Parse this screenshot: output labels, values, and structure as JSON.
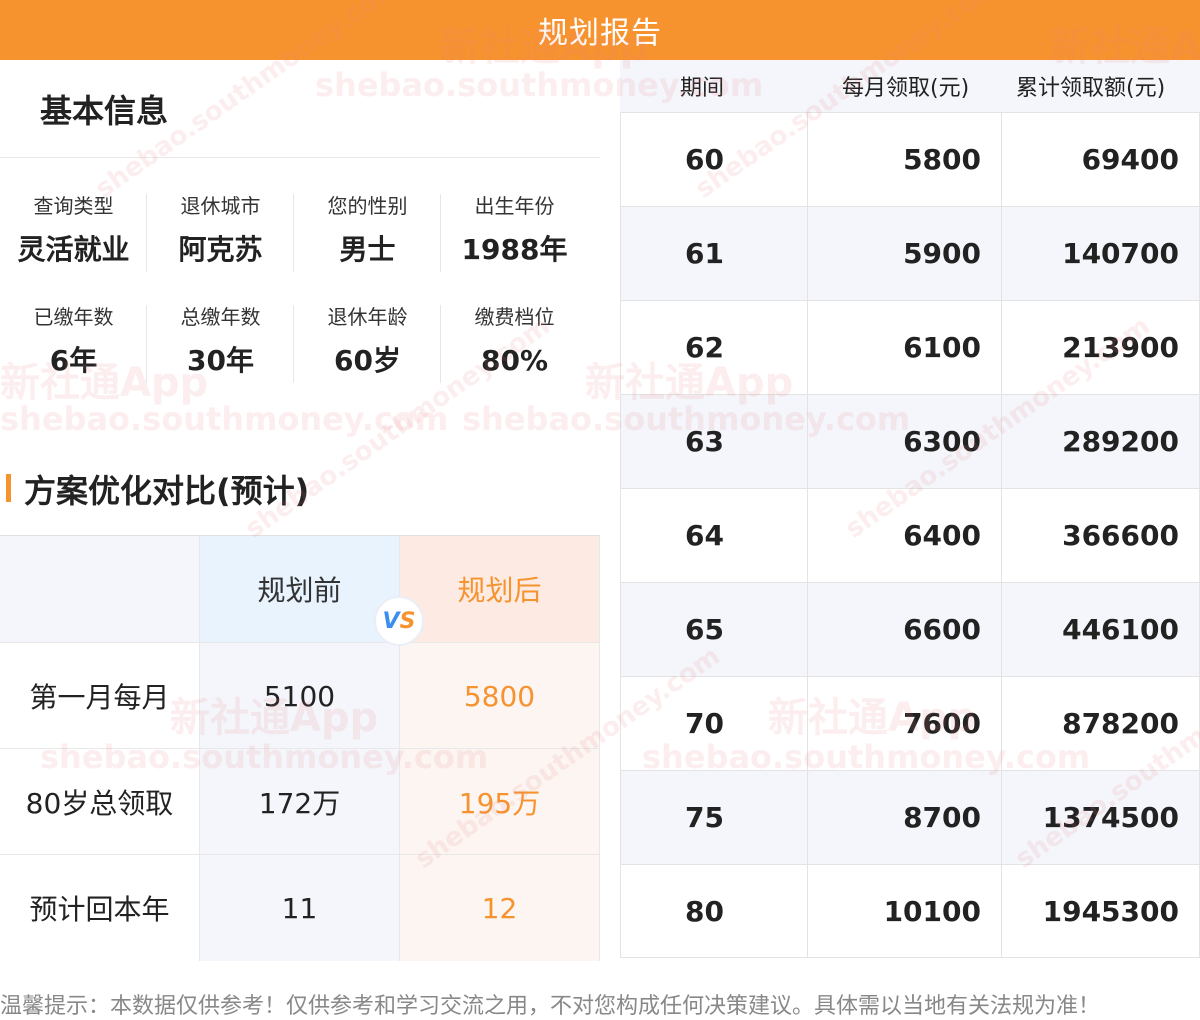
{
  "header": {
    "title": "规划报告"
  },
  "basic_info": {
    "title": "基本信息",
    "items": [
      {
        "label": "查询类型",
        "value": "灵活就业"
      },
      {
        "label": "退休城市",
        "value": "阿克苏"
      },
      {
        "label": "您的性别",
        "value": "男士"
      },
      {
        "label": "出生年份",
        "value": "1988年"
      },
      {
        "label": "已缴年数",
        "value": "6年"
      },
      {
        "label": "总缴年数",
        "value": "30年"
      },
      {
        "label": "退休年龄",
        "value": "60岁"
      },
      {
        "label": "缴费档位",
        "value": "80%"
      }
    ]
  },
  "comparison": {
    "title": "方案优化对比(预计)",
    "before_label": "规划前",
    "after_label": "规划后",
    "vs_v": "V",
    "vs_s": "S",
    "rows": [
      {
        "label": "第一月每月",
        "before": "5100",
        "after": "5800"
      },
      {
        "label": "80岁总领取",
        "before": "172万",
        "after": "195万"
      },
      {
        "label": "预计回本年",
        "before": "11",
        "after": "12"
      }
    ]
  },
  "payout_table": {
    "headers": [
      "期间",
      "每月领取(元)",
      "累计领取额(元)"
    ],
    "rows": [
      {
        "period": "60",
        "monthly": "5800",
        "total": "69400"
      },
      {
        "period": "61",
        "monthly": "5900",
        "total": "140700"
      },
      {
        "period": "62",
        "monthly": "6100",
        "total": "213900"
      },
      {
        "period": "63",
        "monthly": "6300",
        "total": "289200"
      },
      {
        "period": "64",
        "monthly": "6400",
        "total": "366600"
      },
      {
        "period": "65",
        "monthly": "6600",
        "total": "446100"
      },
      {
        "period": "70",
        "monthly": "7600",
        "total": "878200"
      },
      {
        "period": "75",
        "monthly": "8700",
        "total": "1374500"
      },
      {
        "period": "80",
        "monthly": "10100",
        "total": "1945300"
      }
    ]
  },
  "footer": {
    "notice": "温馨提示：本数据仅供参考！仅供参考和学习交流之用，不对您构成任何决策建议。具体需以当地有关法规为准！"
  },
  "watermark": {
    "brand": "新社通App",
    "url": "shebao.southmoney.com"
  },
  "colors": {
    "accent": "#f7932f",
    "before_bg": "#e8f3fd",
    "after_bg": "#fdebe3",
    "vs_blue": "#3b8ef0"
  }
}
